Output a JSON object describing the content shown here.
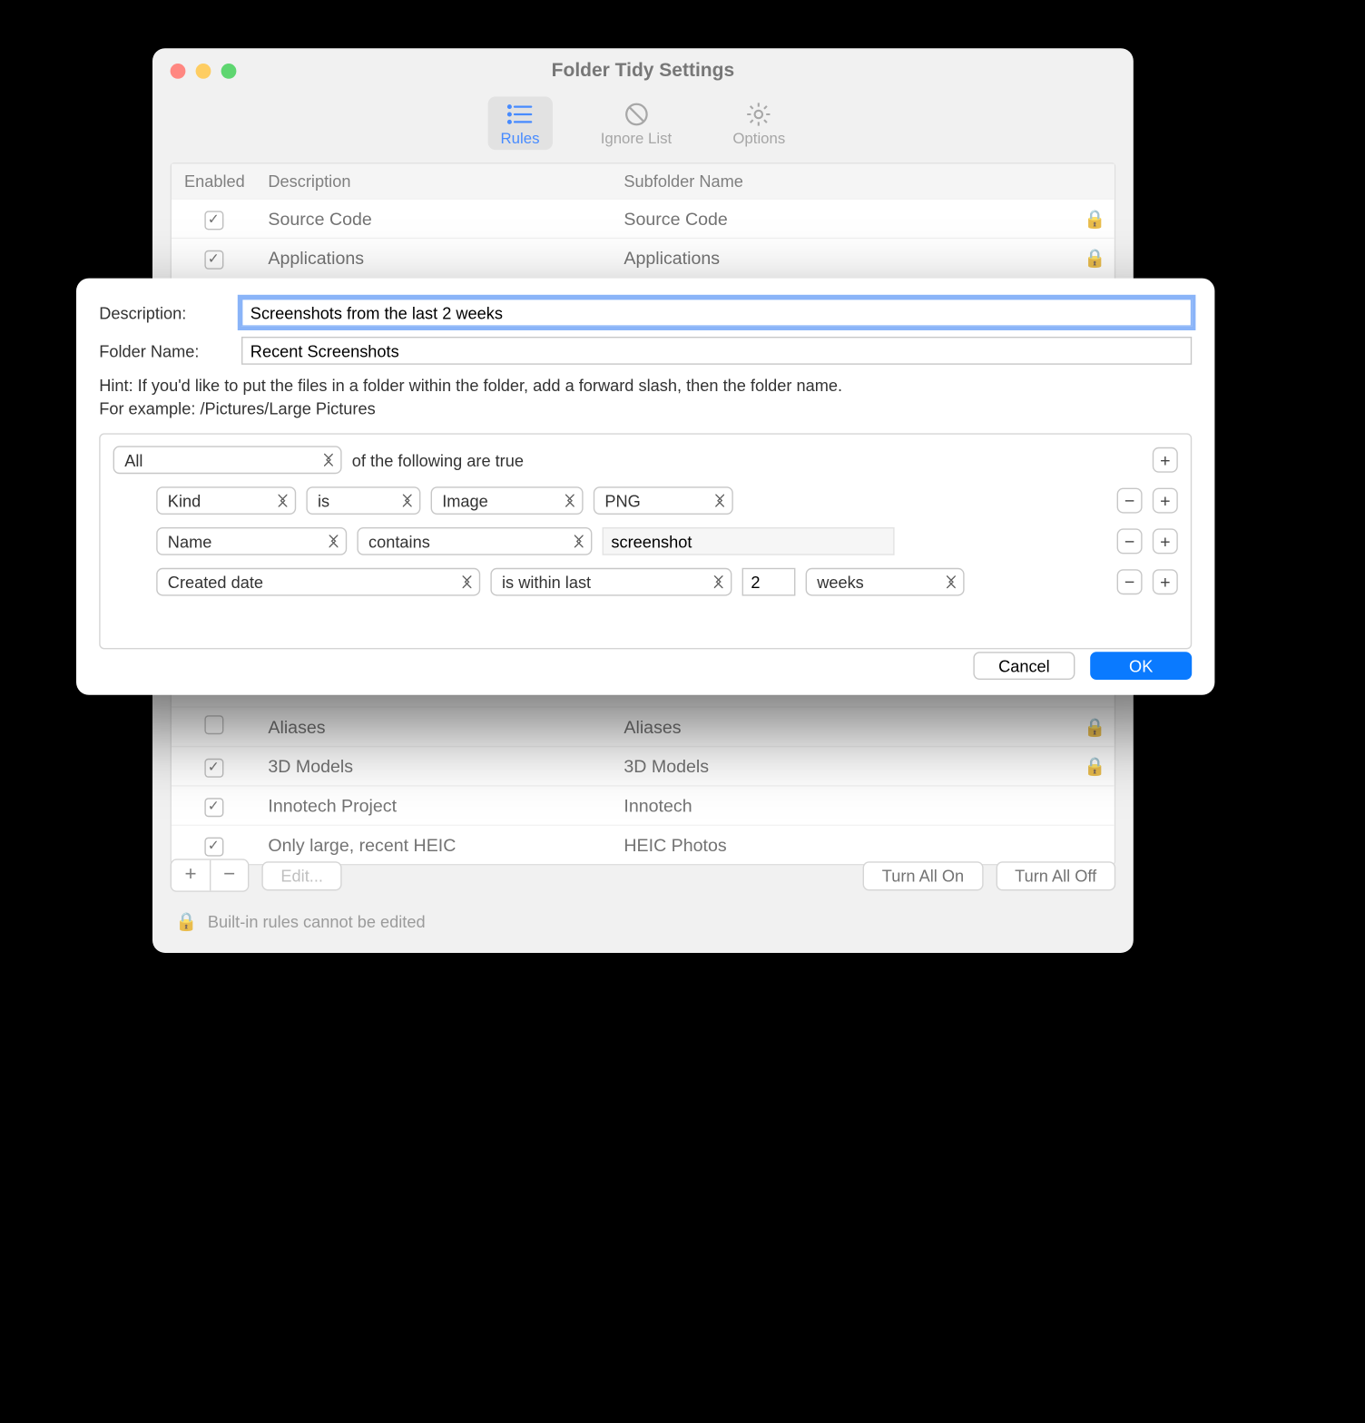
{
  "window": {
    "title": "Folder Tidy Settings",
    "tabs": [
      {
        "label": "Rules",
        "selected": true
      },
      {
        "label": "Ignore List",
        "selected": false
      },
      {
        "label": "Options",
        "selected": false
      }
    ],
    "columns": {
      "enabled": "Enabled",
      "description": "Description",
      "subfolder": "Subfolder Name"
    },
    "rules": [
      {
        "enabled": true,
        "description": "Source Code",
        "subfolder": "Source Code",
        "locked": true
      },
      {
        "enabled": true,
        "description": "Applications",
        "subfolder": "Applications",
        "locked": true
      },
      {
        "enabled": false,
        "description": "Aliases",
        "subfolder": "Aliases",
        "locked": true
      },
      {
        "enabled": true,
        "description": "3D Models",
        "subfolder": "3D Models",
        "locked": true
      },
      {
        "enabled": true,
        "description": "Innotech Project",
        "subfolder": "Innotech",
        "locked": false
      },
      {
        "enabled": true,
        "description": "Only large, recent HEIC",
        "subfolder": "HEIC Photos",
        "locked": false
      }
    ],
    "buttons": {
      "edit": "Edit...",
      "turn_on": "Turn All On",
      "turn_off": "Turn All Off"
    },
    "footer_note": "Built-in rules cannot be edited"
  },
  "sheet": {
    "labels": {
      "description": "Description:",
      "folder_name": "Folder Name:"
    },
    "description_value": "Screenshots from the last 2 weeks",
    "folder_name_value": "Recent Screenshots",
    "hint_line1": "Hint: If you'd like to put the files in a folder within the folder, add a forward slash, then the folder name.",
    "hint_line2": "For example: /Pictures/Large Pictures",
    "builder": {
      "match": "All",
      "match_suffix": "of the following are true",
      "rows": [
        {
          "attr": "Kind",
          "op": "is",
          "class": "Image",
          "type": "PNG"
        },
        {
          "attr": "Name",
          "op": "contains",
          "value": "screenshot"
        },
        {
          "attr": "Created date",
          "op": "is within last",
          "number": "2",
          "unit": "weeks"
        }
      ]
    },
    "buttons": {
      "cancel": "Cancel",
      "ok": "OK"
    }
  }
}
